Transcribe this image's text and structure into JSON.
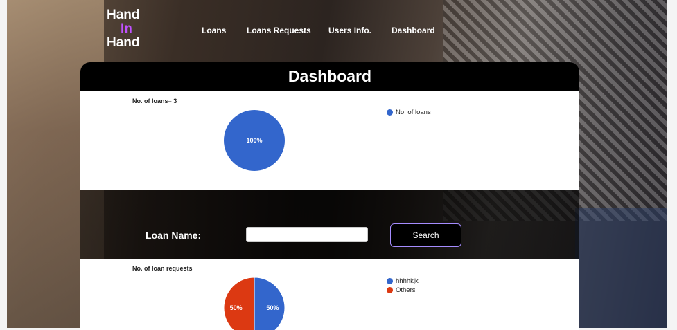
{
  "brand": {
    "line1": "Hand",
    "line2": "In",
    "line3": "Hand",
    "accent_color": "#c052ff"
  },
  "nav": [
    "Loans",
    "Loans Requests",
    "Users Info.",
    "Dashboard"
  ],
  "page_title": "Dashboard",
  "search": {
    "label": "Loan Name:",
    "value": "",
    "placeholder": "",
    "button_label": "Search"
  },
  "chart_data": [
    {
      "type": "pie",
      "title": "No. of loans= 3",
      "categories": [
        "No. of loans"
      ],
      "values": [
        100
      ],
      "labels": [
        "100%"
      ],
      "colors": [
        "#3366cc"
      ],
      "legend": "right"
    },
    {
      "type": "pie",
      "title": "No. of loan requests",
      "categories": [
        "hhhhkjk",
        "Others"
      ],
      "values": [
        50,
        50
      ],
      "labels": [
        "50%",
        "50%"
      ],
      "colors": [
        "#3366cc",
        "#dc3912"
      ],
      "legend": "right"
    }
  ]
}
